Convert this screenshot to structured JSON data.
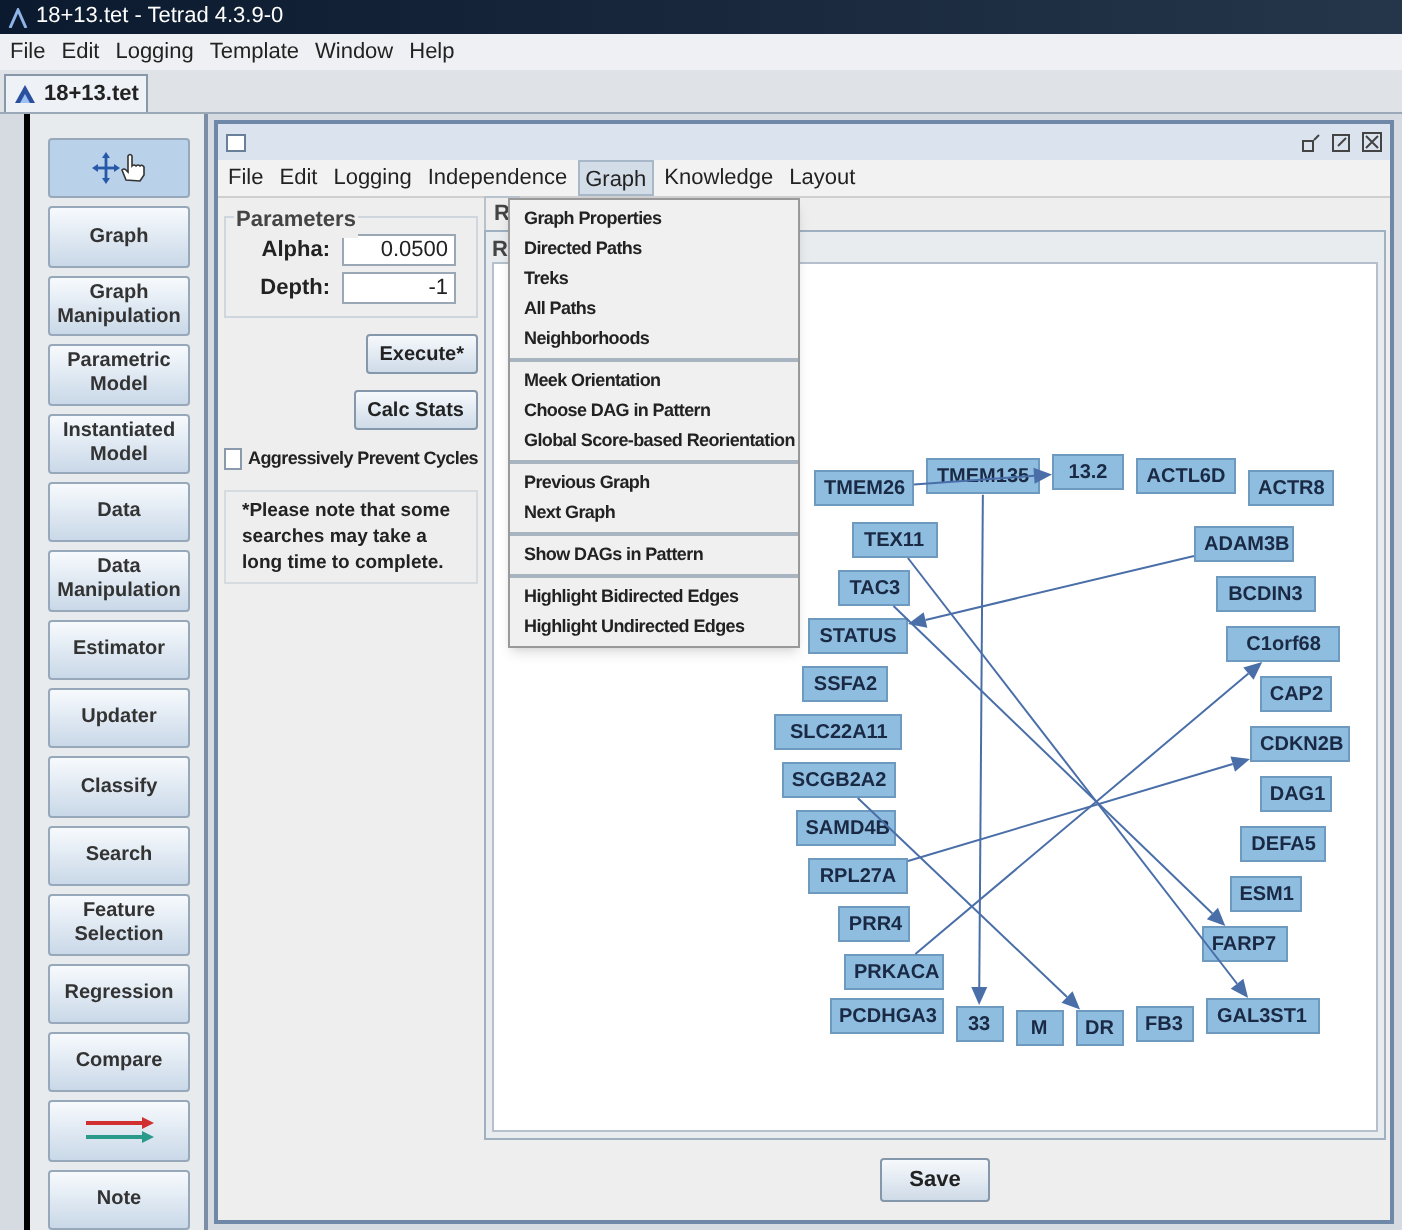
{
  "window": {
    "title": "18+13.tet - Tetrad 4.3.9-0"
  },
  "menu_bar": [
    "File",
    "Edit",
    "Logging",
    "Template",
    "Window",
    "Help"
  ],
  "document_tab": {
    "label": "18+13.tet",
    "selected": true
  },
  "toolbox": [
    {
      "kind": "move",
      "selected": true
    },
    {
      "kind": "label",
      "label": "Graph",
      "selected": false
    },
    {
      "kind": "label",
      "label": "Graph Manipulation",
      "selected": false
    },
    {
      "kind": "label",
      "label": "Parametric Model",
      "selected": false
    },
    {
      "kind": "label",
      "label": "Instantiated Model",
      "selected": false
    },
    {
      "kind": "label",
      "label": "Data",
      "selected": false
    },
    {
      "kind": "label",
      "label": "Data Manipulation",
      "selected": false
    },
    {
      "kind": "label",
      "label": "Estimator",
      "selected": false
    },
    {
      "kind": "label",
      "label": "Updater",
      "selected": false
    },
    {
      "kind": "label",
      "label": "Classify",
      "selected": false
    },
    {
      "kind": "label",
      "label": "Search",
      "selected": false
    },
    {
      "kind": "label",
      "label": "Feature Selection",
      "selected": false
    },
    {
      "kind": "label",
      "label": "Regression",
      "selected": false
    },
    {
      "kind": "label",
      "label": "Compare",
      "selected": false
    },
    {
      "kind": "arrows",
      "selected": false
    },
    {
      "kind": "label",
      "label": "Note",
      "selected": false
    }
  ],
  "editor": {
    "menu_bar": [
      {
        "label": "File",
        "selected": false
      },
      {
        "label": "Edit",
        "selected": false
      },
      {
        "label": "Logging",
        "selected": false
      },
      {
        "label": "Independence",
        "selected": false
      },
      {
        "label": "Graph",
        "selected": true
      },
      {
        "label": "Knowledge",
        "selected": false
      },
      {
        "label": "Layout",
        "selected": false
      }
    ],
    "open_menu": [
      {
        "label": "Graph Properties",
        "separator_before": false
      },
      {
        "label": "Directed Paths",
        "separator_before": false
      },
      {
        "label": "Treks",
        "separator_before": false
      },
      {
        "label": "All Paths",
        "separator_before": false
      },
      {
        "label": "Neighborhoods",
        "separator_before": false
      },
      {
        "label": "Meek Orientation",
        "separator_before": true
      },
      {
        "label": "Choose DAG in Pattern",
        "separator_before": false
      },
      {
        "label": "Global Score-based Reorientation",
        "separator_before": false
      },
      {
        "label": "Previous Graph",
        "separator_before": true
      },
      {
        "label": "Next Graph",
        "separator_before": false
      },
      {
        "label": "Show DAGs in Pattern",
        "separator_before": true
      },
      {
        "label": "Highlight Bidirected Edges",
        "separator_before": true
      },
      {
        "label": "Highlight Undirected Edges",
        "separator_before": false
      }
    ],
    "parameters": {
      "title": "Parameters",
      "fields": [
        {
          "label": "Alpha:",
          "value": "0.0500"
        },
        {
          "label": "Depth:",
          "value": "-1"
        }
      ]
    },
    "buttons": [
      "Execute*",
      "Calc Stats"
    ],
    "checkbox": {
      "label": "Aggressively Prevent Cycles",
      "checked": false
    },
    "note": "*Please note that some searches may take a long time to complete.",
    "result_tab": "R",
    "result_label": "R",
    "graph": {
      "top_nodes": [
        "TMEM26",
        "TMEM135",
        "13.2",
        "ACTL6D",
        "ACTR8"
      ],
      "left_nodes": [
        "TEX11",
        "TAC3",
        "STATUS",
        "SSFA2",
        "SLC22A11",
        "SCGB2A2",
        "SAMD4B",
        "RPL27A",
        "PRR4",
        "PRKACA"
      ],
      "right_nodes": [
        "ADAM3B",
        "BCDIN3",
        "C1orf68",
        "CAP2",
        "CDKN2B",
        "DAG1",
        "DEFA5",
        "ESM1",
        "FARP7"
      ],
      "bottom_nodes": [
        "PCDHGA3",
        "33",
        "M",
        "DR",
        "FB3",
        "GAL3ST1"
      ]
    },
    "save_button": "Save"
  }
}
